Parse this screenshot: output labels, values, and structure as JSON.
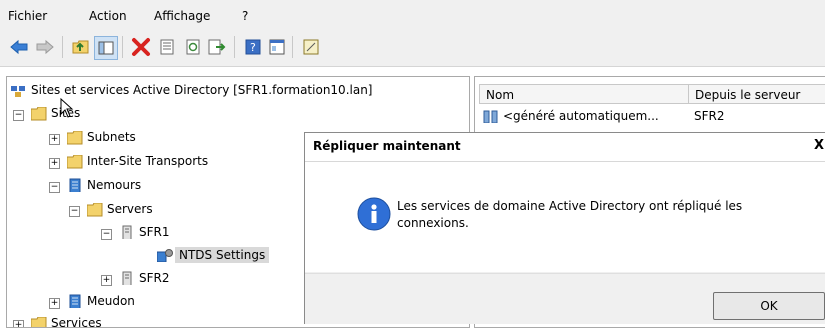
{
  "menu": {
    "items": [
      "Fichier",
      "Action",
      "Affichage",
      "?"
    ]
  },
  "toolbar": {
    "buttons": [
      "back-icon",
      "forward-icon",
      "up-folder-icon",
      "show-tree-icon",
      "delete-icon",
      "properties-icon",
      "refresh-icon",
      "export-icon",
      "help-icon",
      "console-icon",
      "new-window-icon"
    ]
  },
  "tree": {
    "root": "Sites et services Active Directory [SFR1.formation10.lan]",
    "sites": "Sites",
    "subnets": "Subnets",
    "inter_site_transports": "Inter-Site Transports",
    "nemours": "Nemours",
    "servers": "Servers",
    "sfr1": "SFR1",
    "ntds_settings": "NTDS Settings",
    "sfr2": "SFR2",
    "meudon": "Meudon",
    "services": "Services"
  },
  "list": {
    "columns": [
      "Nom",
      "Depuis le serveur"
    ],
    "rows": [
      {
        "name": "<généré automatiquem...",
        "from_server": "SFR2"
      }
    ]
  },
  "dialog": {
    "title": "Répliquer maintenant",
    "message": "Les services de domaine Active Directory ont répliqué les connexions.",
    "ok_label": "OK",
    "close_label": "X"
  }
}
